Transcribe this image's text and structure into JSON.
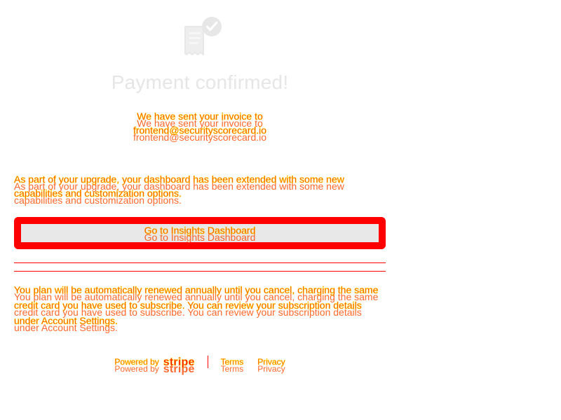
{
  "header": {
    "title": "Payment confirmed!"
  },
  "confirmation": {
    "line1": "We have sent your invoice to",
    "email": "frontend@securityscorecard.io"
  },
  "content": {
    "upgrade_text": "As part of your upgrade, your dashboard has been extended with some new capabilities and customization options.",
    "cta_label": "Go to Insights Dashboard",
    "renewal_text": "You plan will be automatically renewed annually until you cancel, charging the same credit card you have used to subscribe. You can review your subscription details under Account Settings."
  },
  "footer": {
    "powered_by": "Powered by",
    "brand": "stripe",
    "terms": "Terms",
    "privacy": "Privacy"
  },
  "icons": {
    "receipt": "receipt-icon",
    "check": "check-circle-icon"
  },
  "colors": {
    "title_gray": "#e6e6e6",
    "overlay_red": "#ff0000",
    "overlay_yellow": "#ffd700",
    "button_fill": "#e8e8e8",
    "background": "#ffffff"
  }
}
